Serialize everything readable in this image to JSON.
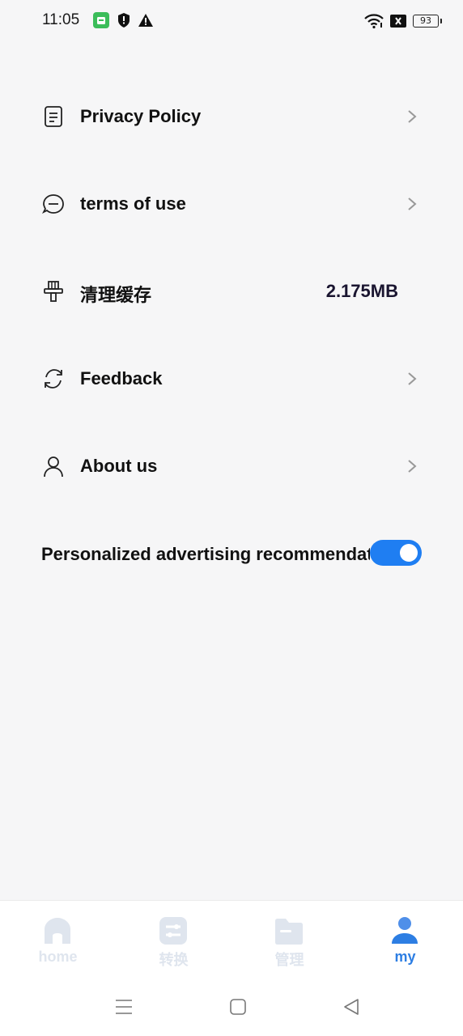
{
  "status_bar": {
    "time": "11:05",
    "battery": "93",
    "icons": [
      "app-notification-icon",
      "shield-icon",
      "warning-icon",
      "wifi-icon",
      "close-box-icon",
      "battery-icon"
    ]
  },
  "settings": {
    "items": [
      {
        "label": "Privacy Policy",
        "icon": "document-icon"
      },
      {
        "label": "terms of use",
        "icon": "chat-bubble-icon"
      },
      {
        "label": "清理缓存",
        "icon": "brush-icon",
        "value": "2.175MB"
      },
      {
        "label": "Feedback",
        "icon": "refresh-icon"
      },
      {
        "label": "About us",
        "icon": "person-icon"
      }
    ],
    "ad_toggle": {
      "label": "Personalized advertising recommendation",
      "on": true
    }
  },
  "bottom_nav": {
    "tabs": [
      {
        "label": "home",
        "icon": "home-icon"
      },
      {
        "label": "转换",
        "icon": "convert-icon"
      },
      {
        "label": "管理",
        "icon": "folder-icon"
      },
      {
        "label": "my",
        "icon": "user-icon",
        "active": true
      }
    ]
  },
  "colors": {
    "accent": "#1f7ef2",
    "inactive_tab": "#dfe5ee",
    "background": "#f6f6f7"
  }
}
